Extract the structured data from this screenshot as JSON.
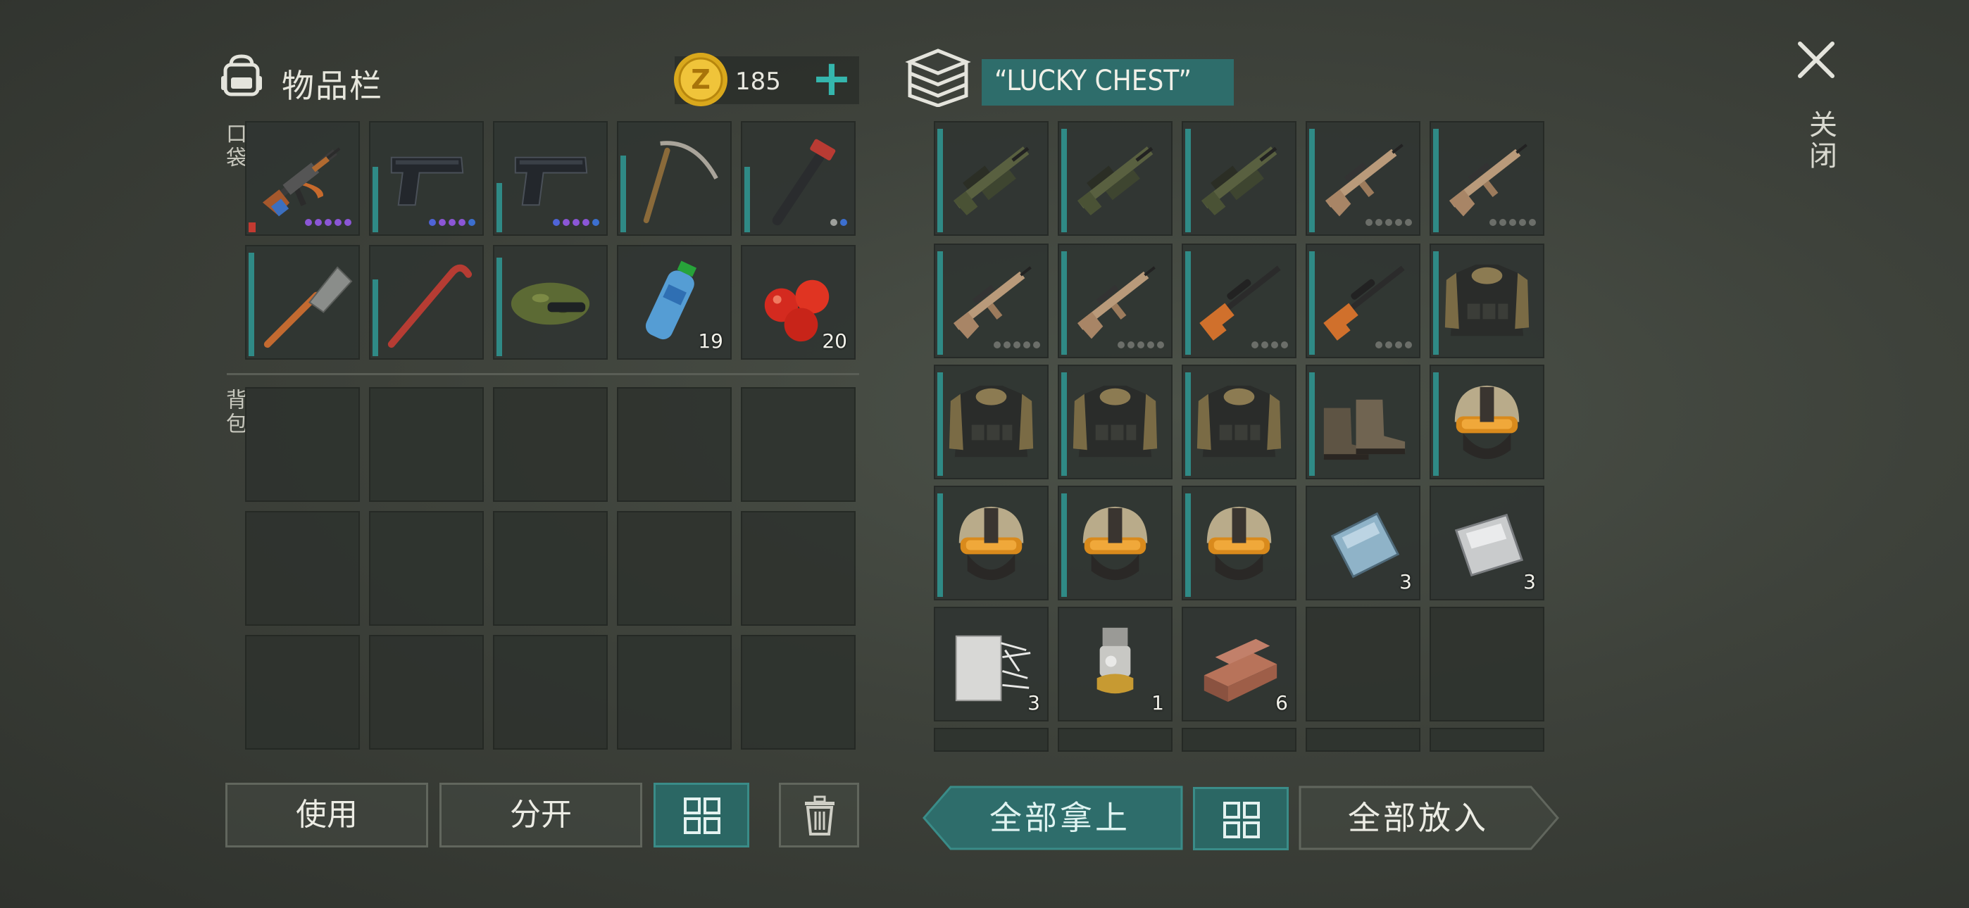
{
  "inventory": {
    "title": "物品栏",
    "coins": "185",
    "pocket_label": "口袋",
    "backpack_label": "背包",
    "pocket_slots": [
      {
        "name": "ak-rifle-icon",
        "durability": 0.05,
        "dots": [
          "#8b56d6",
          "#8b56d6",
          "#8b56d6",
          "#8b56d6",
          "#8b56d6"
        ],
        "red": true
      },
      {
        "name": "pistol-icon",
        "durability": 0.6,
        "dots": [
          "#4f64d8",
          "#8b56d6",
          "#8b56d6",
          "#8b56d6",
          "#3c6fcf"
        ]
      },
      {
        "name": "pistol-icon",
        "durability": 0.45,
        "dots": [
          "#4f64d8",
          "#8b56d6",
          "#8b56d6",
          "#8b56d6",
          "#3c6fcf"
        ]
      },
      {
        "name": "pickaxe-icon",
        "durability": 0.7
      },
      {
        "name": "hammer-icon",
        "durability": 0.6,
        "dots": [
          "#9ea09c",
          "#3c6fcf"
        ]
      },
      {
        "name": "shovel-icon",
        "durability": 0.95
      },
      {
        "name": "crowbar-icon",
        "durability": 0.7
      },
      {
        "name": "camo-cap-icon",
        "durability": 0.9
      },
      {
        "name": "water-bottle-icon",
        "count": "19"
      },
      {
        "name": "apples-icon",
        "count": "20"
      }
    ]
  },
  "chest": {
    "title": "“LUCKY CHEST”",
    "slots": [
      {
        "name": "grenade-launcher-rifle-icon",
        "durability": 0.95
      },
      {
        "name": "grenade-launcher-rifle-icon",
        "durability": 0.95
      },
      {
        "name": "grenade-launcher-rifle-icon",
        "durability": 0.95
      },
      {
        "name": "tan-rifle-icon",
        "durability": 0.95,
        "dots": [
          "#6b6e69",
          "#6b6e69",
          "#6b6e69",
          "#6b6e69",
          "#6b6e69"
        ]
      },
      {
        "name": "tan-rifle-icon",
        "durability": 0.95,
        "dots": [
          "#6b6e69",
          "#6b6e69",
          "#6b6e69",
          "#6b6e69",
          "#6b6e69"
        ]
      },
      {
        "name": "tan-rifle-icon",
        "durability": 0.95,
        "dots": [
          "#6b6e69",
          "#6b6e69",
          "#6b6e69",
          "#6b6e69",
          "#6b6e69"
        ]
      },
      {
        "name": "tan-rifle-icon",
        "durability": 0.95,
        "dots": [
          "#6b6e69",
          "#6b6e69",
          "#6b6e69",
          "#6b6e69",
          "#6b6e69"
        ]
      },
      {
        "name": "orange-sniper-rifle-icon",
        "durability": 0.95,
        "dots": [
          "#6b6e69",
          "#6b6e69",
          "#6b6e69",
          "#6b6e69"
        ]
      },
      {
        "name": "orange-sniper-rifle-icon",
        "durability": 0.95,
        "dots": [
          "#6b6e69",
          "#6b6e69",
          "#6b6e69",
          "#6b6e69"
        ]
      },
      {
        "name": "tactical-vest-icon",
        "durability": 0.95
      },
      {
        "name": "tactical-vest-icon",
        "durability": 0.95
      },
      {
        "name": "tactical-vest-icon",
        "durability": 0.95
      },
      {
        "name": "tactical-vest-icon",
        "durability": 0.95
      },
      {
        "name": "boots-icon",
        "durability": 0.95
      },
      {
        "name": "tactical-helmet-icon",
        "durability": 0.95
      },
      {
        "name": "tactical-helmet-icon",
        "durability": 0.95
      },
      {
        "name": "tactical-helmet-icon",
        "durability": 0.95
      },
      {
        "name": "tactical-helmet-icon",
        "durability": 0.95
      },
      {
        "name": "glass-sheet-icon",
        "count": "3"
      },
      {
        "name": "steel-plate-icon",
        "count": "3"
      },
      {
        "name": "fiberglass-roll-icon",
        "count": "3"
      },
      {
        "name": "spring-mechanism-icon",
        "count": "1"
      },
      {
        "name": "bricks-icon",
        "count": "6"
      },
      null,
      null
    ]
  },
  "buttons": {
    "use": "使用",
    "split": "分开",
    "take_all": "全部拿上",
    "put_all": "全部放入",
    "close": "关闭"
  },
  "colors": {
    "accent": "#2e6d6b",
    "accent_border": "#3a8c88",
    "plus": "#35b6ad",
    "durability": "#2f8a86"
  }
}
